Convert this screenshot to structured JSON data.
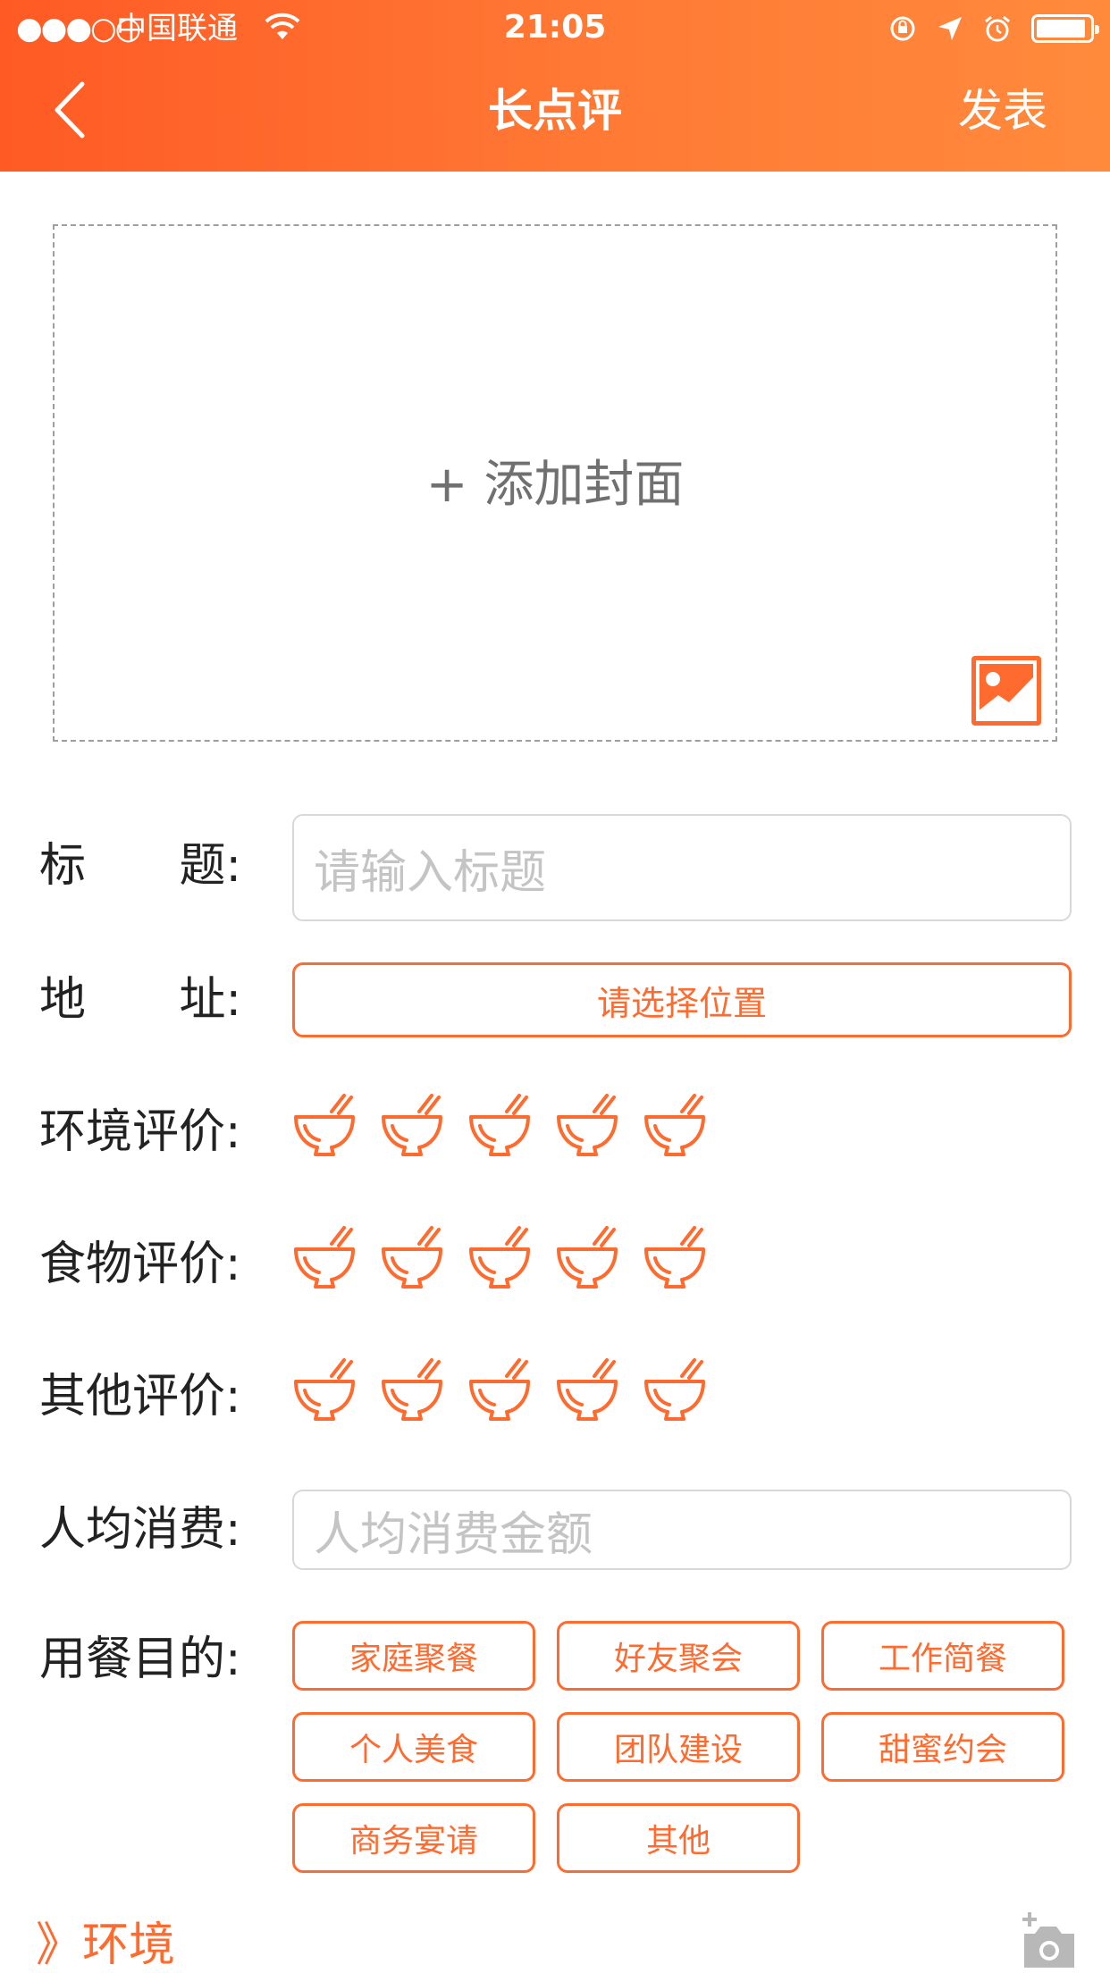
{
  "status_bar": {
    "signal": "●●●○○",
    "carrier": "中国联通",
    "time": "21:05"
  },
  "nav": {
    "title": "长点评",
    "publish_label": "发表"
  },
  "cover": {
    "add_label": "+ 添加封面"
  },
  "form": {
    "title_label": "标题:",
    "title_placeholder": "请输入标题",
    "address_label": "地址:",
    "address_button": "请选择位置",
    "ratings": [
      {
        "label": "环境评价:",
        "value": 0,
        "max": 5
      },
      {
        "label": "食物评价:",
        "value": 0,
        "max": 5
      },
      {
        "label": "其他评价:",
        "value": 0,
        "max": 5
      }
    ],
    "spend_label": "人均消费:",
    "spend_placeholder": "人均消费金额",
    "purpose_label": "用餐目的:",
    "purposes": [
      "家庭聚餐",
      "好友聚会",
      "工作简餐",
      "个人美食",
      "团队建设",
      "甜蜜约会",
      "商务宴请",
      "其他"
    ]
  },
  "section": {
    "environment_label": "》环境"
  },
  "colors": {
    "accent": "#ff6a2e",
    "header_start": "#ff5a24",
    "header_end": "#ff8a3c",
    "placeholder": "#c4c4c4"
  },
  "icons": {
    "back": "chevron-left-icon",
    "cover_image": "image-icon",
    "rating": "bowl-icon",
    "add_photo": "camera-plus-icon"
  }
}
